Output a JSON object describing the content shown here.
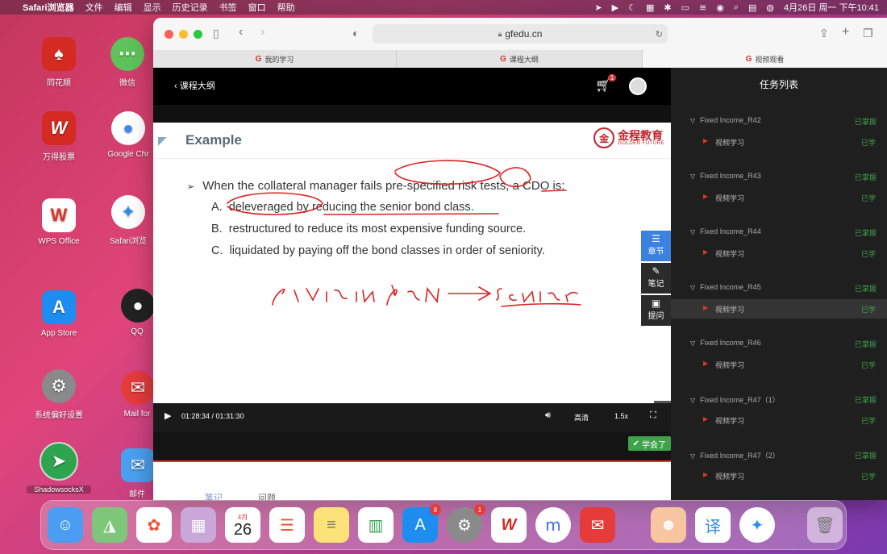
{
  "menubar": {
    "app": "Safari浏览器",
    "items": [
      "文件",
      "编辑",
      "显示",
      "历史记录",
      "书签",
      "窗口",
      "帮助"
    ],
    "clock": "4月26日 周一 下午10:41"
  },
  "desktop": {
    "icons": [
      {
        "label": "同花顺"
      },
      {
        "label": "微信"
      },
      {
        "label": "万得股票"
      },
      {
        "label": "Google Chr"
      },
      {
        "label": "WPS Office"
      },
      {
        "label": "Safari浏览"
      },
      {
        "label": "App Store"
      },
      {
        "label": "QQ"
      },
      {
        "label": "系统偏好设置"
      },
      {
        "label": "Mail for"
      },
      {
        "label": "ShadowsocksX"
      },
      {
        "label": "邮件"
      }
    ]
  },
  "browser": {
    "url": "gfedu.cn",
    "tabs": [
      "我的学习",
      "课程大纲",
      "视频观看"
    ]
  },
  "player": {
    "back_label": "课程大纲",
    "cart_badge": "1",
    "slide": {
      "title": "Example",
      "brand_name": "金程教育",
      "brand_sub": "GOLDEN FUTURE",
      "question": "When the collateral manager fails pre-specified risk tests, a CDO is:",
      "options": [
        {
          "letter": "A.",
          "text": "deleveraged by reducing the senior bond class."
        },
        {
          "letter": "B.",
          "text": "restructured to reduce its most expensive funding source."
        },
        {
          "letter": "C.",
          "text": "liquidated by paying off the bond classes in order of seniority."
        }
      ]
    },
    "side_buttons": [
      "章节",
      "笔记",
      "提问"
    ],
    "time": "01:28:34 / 01:31:30",
    "progress": 0.968,
    "quality": "高清",
    "speed": "1.5x",
    "learned_label": "学会了",
    "lower_tabs": [
      "笔记",
      "问题"
    ]
  },
  "tasks": {
    "title": "任务列表",
    "groups": [
      {
        "name": "Fixed Income_R42",
        "status": "已掌握",
        "item": "视频学习",
        "item_status": "已学"
      },
      {
        "name": "Fixed Income_R43",
        "status": "已掌握",
        "item": "视频学习",
        "item_status": "已学"
      },
      {
        "name": "Fixed Income_R44",
        "status": "已掌握",
        "item": "视频学习",
        "item_status": "已学"
      },
      {
        "name": "Fixed Income_R45",
        "status": "已掌握",
        "item": "视频学习",
        "item_status": "已学"
      },
      {
        "name": "Fixed Income_R46",
        "status": "已掌握",
        "item": "视频学习",
        "item_status": "已学"
      },
      {
        "name": "Fixed Income_R47（1）",
        "status": "已掌握",
        "item": "视频学习",
        "item_status": "已学"
      },
      {
        "name": "Fixed Income_R47（2）",
        "status": "已掌握",
        "item": "视频学习",
        "item_status": "已学"
      }
    ]
  },
  "dock": {
    "calendar_month": "4月",
    "calendar_day": "26",
    "app_store_badge": "8",
    "settings_badge": "1"
  }
}
